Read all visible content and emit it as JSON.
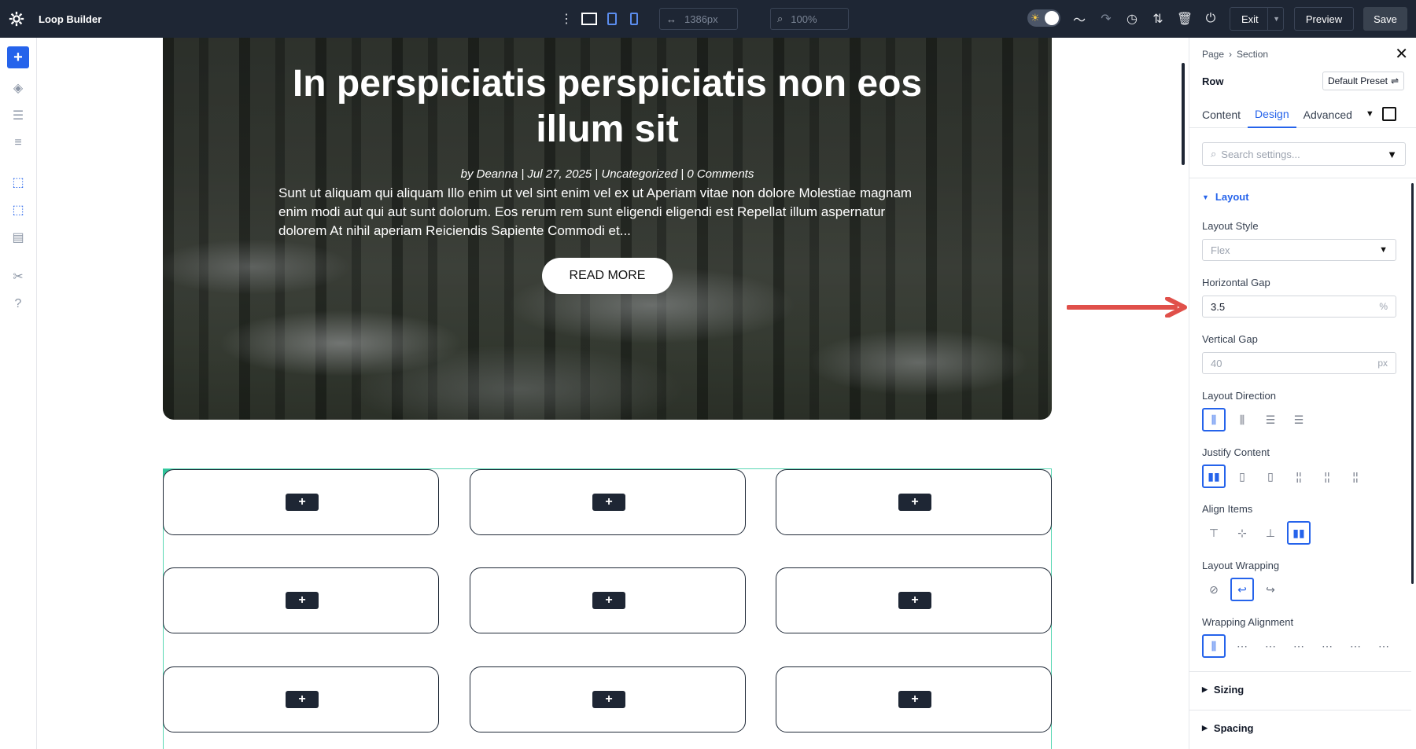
{
  "app": {
    "title": "Loop Builder"
  },
  "toolbar": {
    "width_value": "1386px",
    "zoom_value": "100%",
    "exit_label": "Exit",
    "preview_label": "Preview",
    "save_label": "Save"
  },
  "hero": {
    "title": "In perspiciatis perspiciatis non eos illum sit",
    "meta": "by Deanna | Jul 27, 2025 | Uncategorized | 0 Comments",
    "excerpt": "Sunt ut aliquam qui aliquam Illo enim ut vel sint enim vel ex ut Aperiam vitae non dolore Molestiae magnam enim modi aut qui aut sunt dolorum. Eos rerum rem sunt eligendi eligendi est Repellat illum aspernatur dolorem At nihil aperiam Reiciendis Sapiente Commodi et...",
    "button_label": "READ MORE"
  },
  "grid": {
    "add_glyph": "+"
  },
  "panel": {
    "breadcrumb": [
      "Page",
      "Section"
    ],
    "breadcrumb_sep": "›",
    "element_label": "Row",
    "preset_label": "Default Preset",
    "tabs": [
      "Content",
      "Design",
      "Advanced"
    ],
    "active_tab": "Design",
    "search_placeholder": "Search settings...",
    "layout_section": "Layout",
    "layout_style_label": "Layout Style",
    "layout_style_value": "Flex",
    "horizontal_gap_label": "Horizontal Gap",
    "horizontal_gap_value": "3.5",
    "horizontal_gap_unit": "%",
    "vertical_gap_label": "Vertical Gap",
    "vertical_gap_placeholder": "40",
    "vertical_gap_unit": "px",
    "layout_direction_label": "Layout Direction",
    "justify_content_label": "Justify Content",
    "align_items_label": "Align Items",
    "layout_wrapping_label": "Layout Wrapping",
    "wrapping_alignment_label": "Wrapping Alignment",
    "sizing_section": "Sizing",
    "spacing_section": "Spacing"
  },
  "colors": {
    "topbar": "#1e2634",
    "accent": "#2563eb",
    "row_outline": "#2fc49a",
    "arrow": "#e0504a"
  }
}
